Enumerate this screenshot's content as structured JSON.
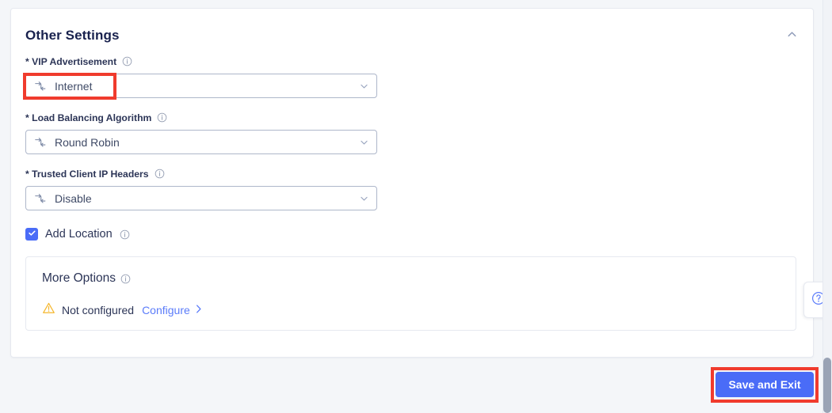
{
  "card": {
    "title": "Other Settings",
    "collapse_icon": "chevron-up-icon"
  },
  "fields": [
    {
      "label": "* VIP Advertisement",
      "required_marker": "*",
      "info_icon": "info-icon",
      "value": "Internet",
      "value_icon": "network-transfer-icon",
      "caret_icon": "chevron-down-icon"
    },
    {
      "label": "* Load Balancing Algorithm",
      "required_marker": "*",
      "info_icon": "info-icon",
      "value": "Round Robin",
      "value_icon": "network-transfer-icon",
      "caret_icon": "chevron-down-icon"
    },
    {
      "label": "* Trusted Client IP Headers",
      "required_marker": "*",
      "info_icon": "info-icon",
      "value": "Disable",
      "value_icon": "network-transfer-icon",
      "caret_icon": "chevron-down-icon"
    }
  ],
  "checkbox": {
    "label": "Add Location",
    "checked": true,
    "info_icon": "info-icon",
    "check_icon": "checkmark-icon"
  },
  "more_options": {
    "title": "More Options",
    "info_icon": "info-icon",
    "warning_icon": "warning-triangle-icon",
    "status": "Not configured",
    "link_label": "Configure",
    "link_icon": "chevron-right-icon"
  },
  "footer": {
    "save_label": "Save and Exit"
  },
  "help": {
    "icon": "question-circle-icon"
  },
  "colors": {
    "accent": "#4a6cf7",
    "link": "#5b7cfa",
    "title": "#19224e",
    "text": "#2c3557",
    "warning": "#f5b72e",
    "highlight": "#f03b2d",
    "page_bg": "#f4f6f9",
    "border": "#aeb7ca"
  }
}
